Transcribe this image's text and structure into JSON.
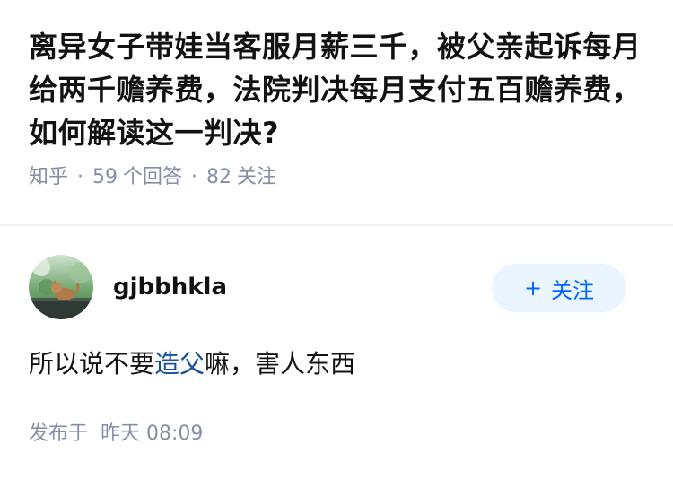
{
  "question": {
    "title": "离异女子带娃当客服月薪三千，被父亲起诉每月给两千赡养费，法院判决每月支付五百赡养费，如何解读这一判决?",
    "source": "知乎",
    "separator": "·",
    "answer_count": "59",
    "answer_label": "个回答",
    "follower_count": "82",
    "follower_label": "关注"
  },
  "answer": {
    "author_name": "gjbbhkla",
    "follow_button": {
      "icon": "plus-icon",
      "plus": "+",
      "label": "关注"
    },
    "content_before": "所以说不要",
    "content_link": "造父",
    "content_after": "嘛，害人东西",
    "published_label": "发布于",
    "published_time": "昨天 08:09"
  },
  "colors": {
    "link": "#175199",
    "accent": "#0066ff",
    "muted": "#8590a6",
    "follow_bg": "#ebf5ff"
  }
}
